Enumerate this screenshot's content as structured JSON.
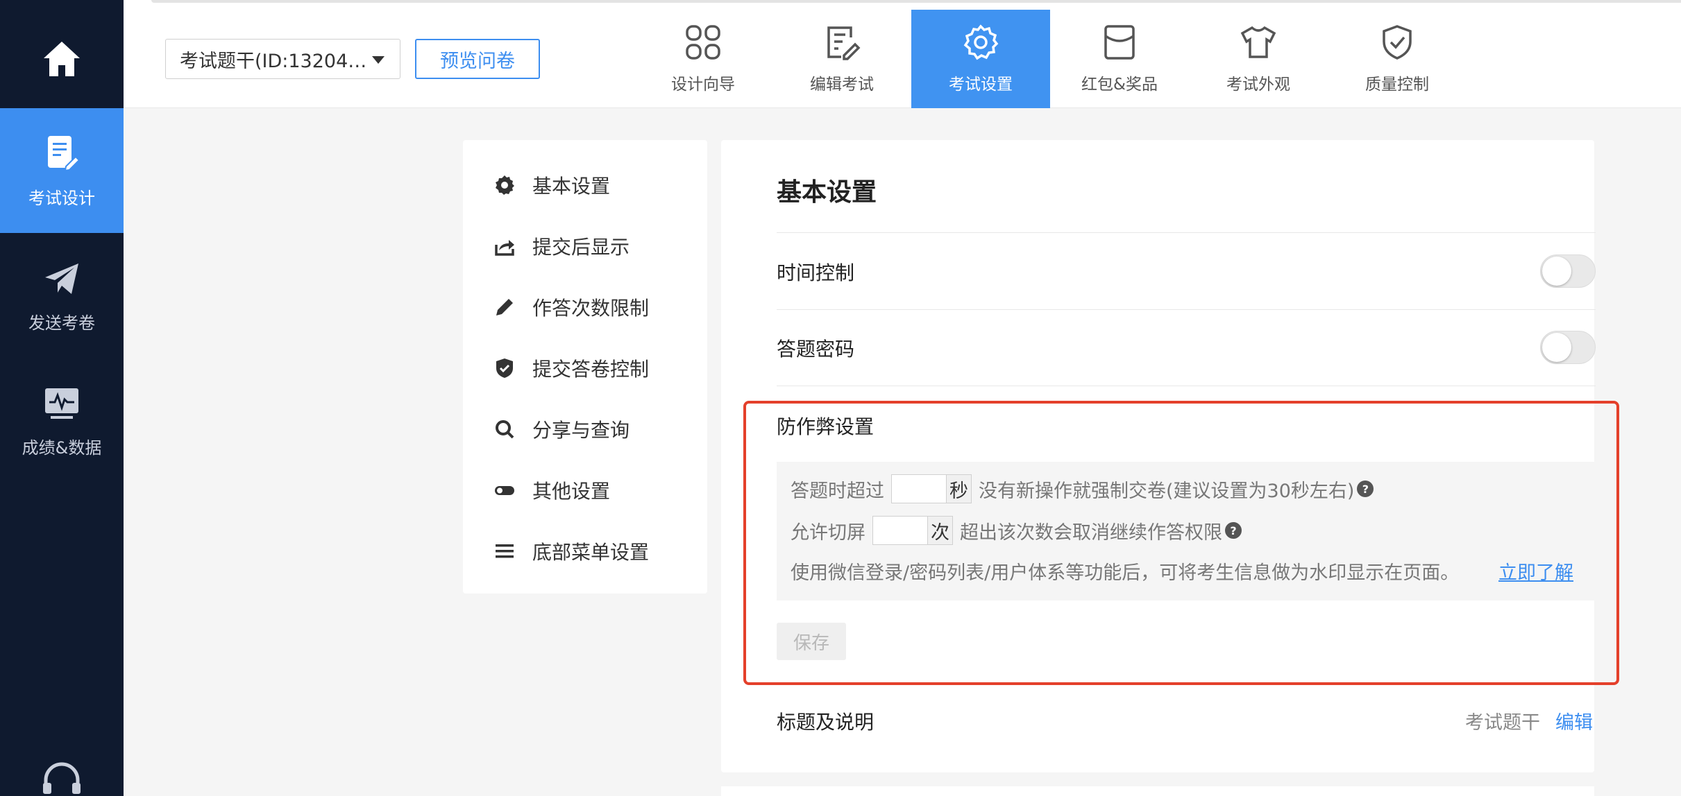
{
  "sidebar": {
    "items": [
      {
        "label": "考试设计",
        "icon": "exam-design-icon"
      },
      {
        "label": "发送考卷",
        "icon": "paper-plane-icon"
      },
      {
        "label": "成绩&数据",
        "icon": "chart-monitor-icon"
      }
    ]
  },
  "header": {
    "survey_select": "考试题干(ID:13204…",
    "preview_label": "预览问卷",
    "tabs": [
      {
        "label": "设计向导",
        "icon": "grid-icon"
      },
      {
        "label": "编辑考试",
        "icon": "edit-doc-icon"
      },
      {
        "label": "考试设置",
        "icon": "gear-icon"
      },
      {
        "label": "红包&奖品",
        "icon": "red-envelope-icon"
      },
      {
        "label": "考试外观",
        "icon": "shirt-icon"
      },
      {
        "label": "质量控制",
        "icon": "shield-check-icon"
      }
    ]
  },
  "menu": {
    "items": [
      {
        "label": "基本设置",
        "icon": "gear-icon"
      },
      {
        "label": "提交后显示",
        "icon": "share-out-icon"
      },
      {
        "label": "作答次数限制",
        "icon": "pencil-icon"
      },
      {
        "label": "提交答卷控制",
        "icon": "shield-check-icon"
      },
      {
        "label": "分享与查询",
        "icon": "search-icon"
      },
      {
        "label": "其他设置",
        "icon": "toggle-icon"
      },
      {
        "label": "底部菜单设置",
        "icon": "menu-lines-icon"
      }
    ]
  },
  "content": {
    "title": "基本设置",
    "time_control": "时间控制",
    "answer_password": "答题密码",
    "anti_cheat": {
      "title": "防作弊设置",
      "line1_prefix": "答题时超过",
      "line1_unit": "秒",
      "line1_suffix": "没有新操作就强制交卷(建议设置为30秒左右)",
      "line2_prefix": "允许切屏",
      "line2_unit": "次",
      "line2_suffix": "超出该次数会取消继续作答权限",
      "line3_text": "使用微信登录/密码列表/用户体系等功能后，可将考生信息做为水印显示在页面。",
      "learn_more": "立即了解",
      "help_glyph": "?",
      "save_label": "保存"
    },
    "title_desc_label": "标题及说明",
    "title_desc_value": "考试题干",
    "edit_label": "编辑"
  },
  "colors": {
    "sidebar_bg": "#0f1a2f",
    "accent": "#3d8ef0",
    "highlight_border": "#e4402b"
  }
}
